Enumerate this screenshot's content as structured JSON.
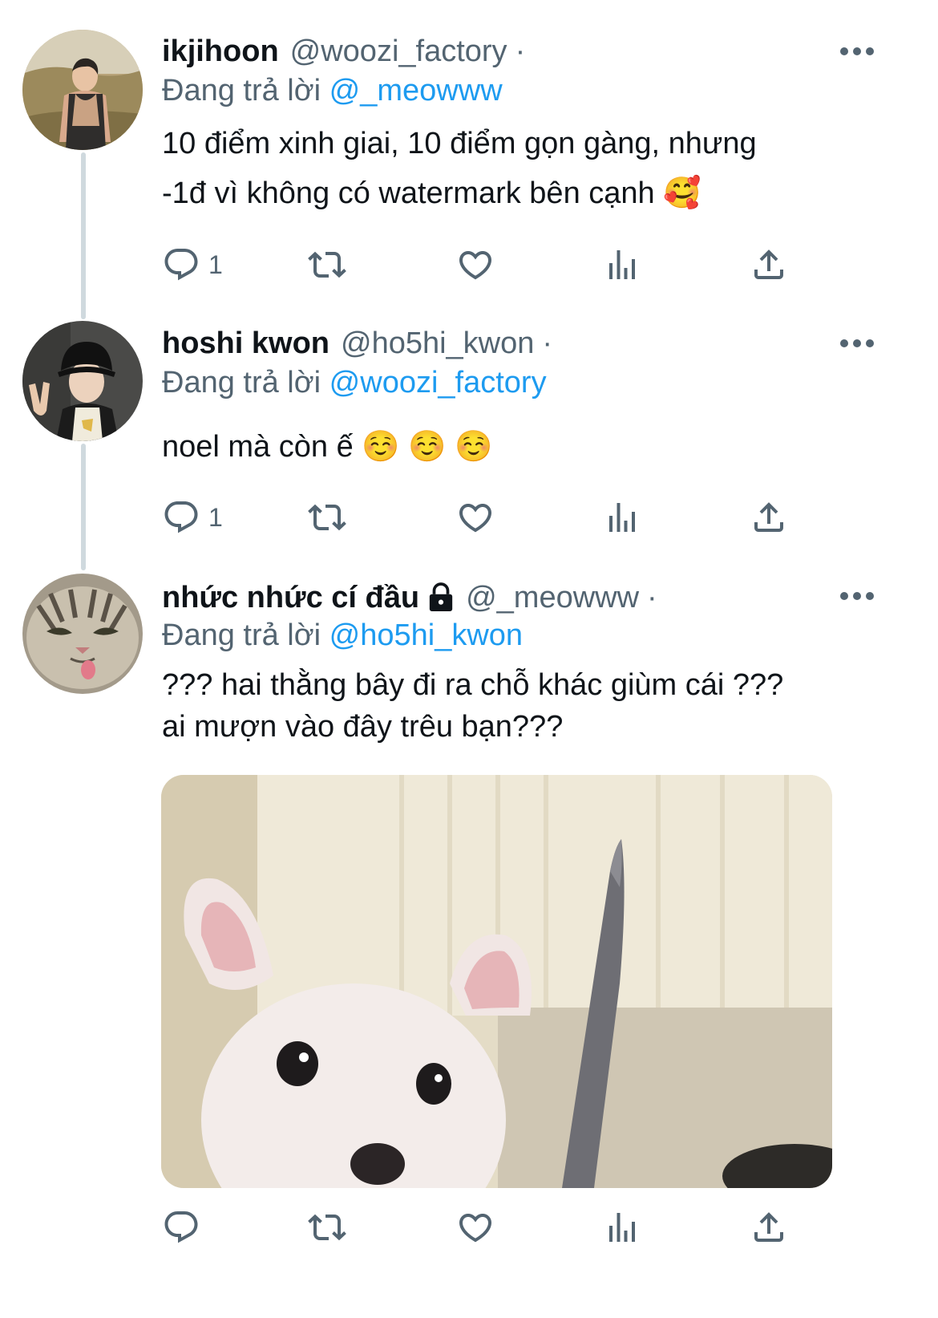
{
  "tweets": [
    {
      "name": "ikjihoon",
      "handle": "@woozi_factory",
      "dot": "·",
      "replying_prefix": "Đang trả lời",
      "replying_to": "@_meowww",
      "text_lines": [
        "10 điểm xinh giai, 10 điểm gọn gàng, nhưng",
        "-1đ vì không có watermark bên cạnh 🥰"
      ],
      "reply_count": "1",
      "avatar_icon": "avatar-photo-man-outdoor"
    },
    {
      "name": "hoshi kwon",
      "handle": "@ho5hi_kwon",
      "dot": "·",
      "replying_prefix": "Đang trả lời",
      "replying_to": "@woozi_factory",
      "text_lines": [
        "noel mà còn ế ☺️ ☺️ ☺️"
      ],
      "reply_count": "1",
      "avatar_icon": "avatar-photo-man-bucket-hat"
    },
    {
      "name": "nhức nhức cí đầu",
      "handle": "@_meowww",
      "dot": "·",
      "replying_prefix": "Đang trả lời",
      "replying_to": "@ho5hi_kwon",
      "text_lines": [
        "??? hai thằng bây đi ra chỗ khác giùm cái ???",
        "ai mượn vào đây trêu bạn???"
      ],
      "reply_count": "",
      "avatar_icon": "avatar-photo-cat",
      "protected_icon": "lock-icon",
      "media_icon": "image-dog-with-knife"
    }
  ],
  "colors": {
    "link": "#1d9bf0",
    "secondary": "#536471",
    "thread_line": "#cfd9de",
    "text": "#0f1419"
  },
  "action_icons": [
    "reply-icon",
    "retweet-icon",
    "like-icon",
    "views-icon",
    "share-icon"
  ]
}
